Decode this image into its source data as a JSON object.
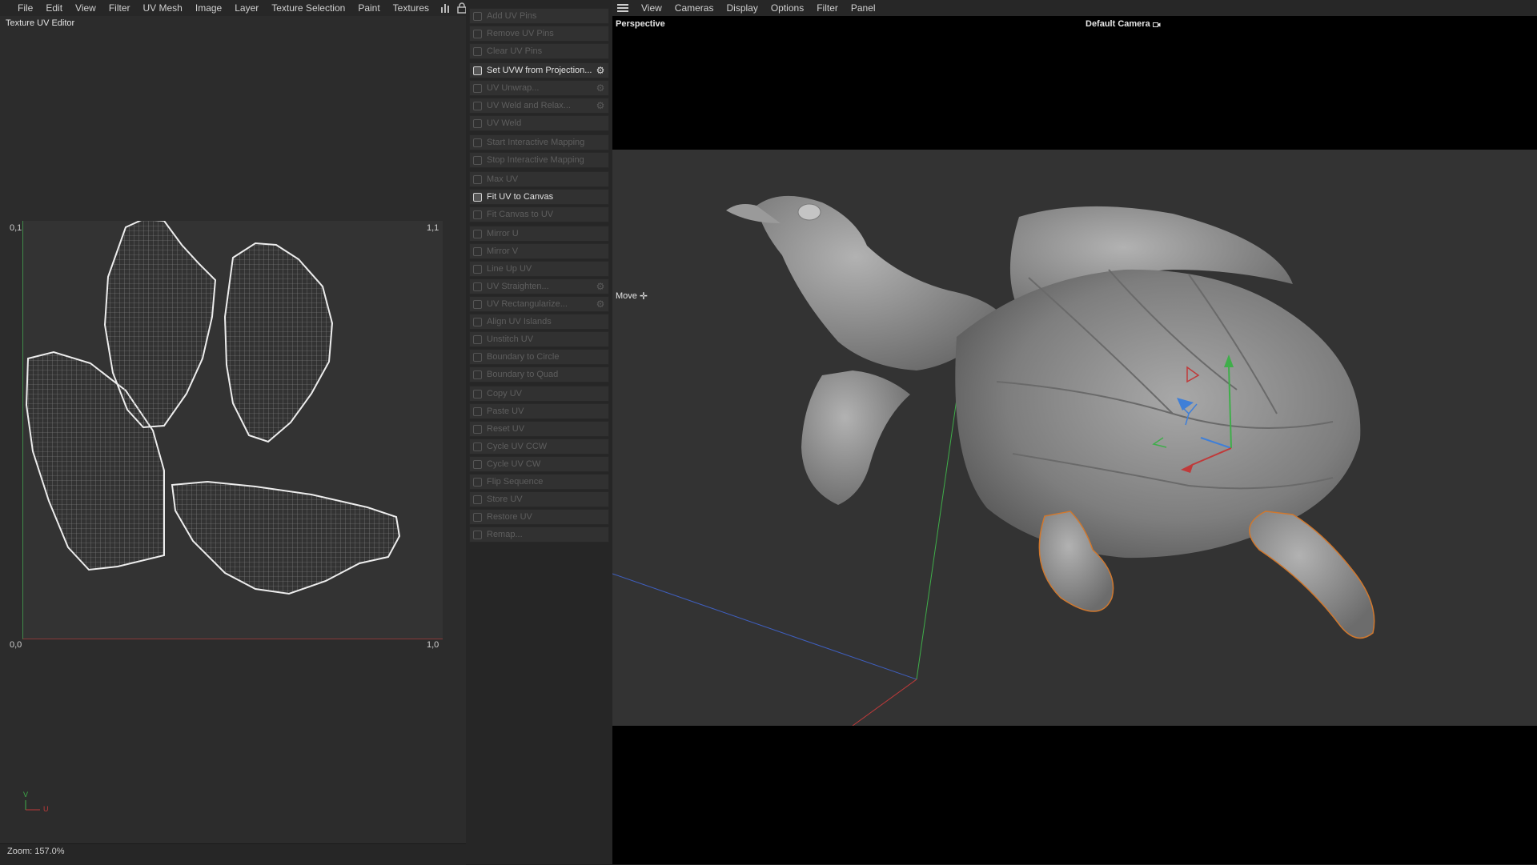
{
  "uv_editor": {
    "menu": [
      "File",
      "Edit",
      "View",
      "Filter",
      "UV Mesh",
      "Image",
      "Layer",
      "Texture Selection",
      "Paint",
      "Textures"
    ],
    "title": "Texture UV Editor",
    "corners": {
      "top_left": "0,1",
      "top_right": "1,1",
      "bottom_left": "0,0",
      "bottom_right": "1,0"
    },
    "axis_v": "V",
    "axis_u": "U",
    "zoom": "Zoom: 157.0%"
  },
  "command_panel": {
    "groups": [
      [
        {
          "label": "Add UV Pins",
          "enabled": false
        },
        {
          "label": "Remove UV Pins",
          "enabled": false
        },
        {
          "label": "Clear UV Pins",
          "enabled": false
        }
      ],
      [
        {
          "label": "Set UVW from Projection...",
          "enabled": true,
          "gear": true
        },
        {
          "label": "UV Unwrap...",
          "enabled": false,
          "gear": true
        },
        {
          "label": "UV Weld and Relax...",
          "enabled": false,
          "gear": true
        },
        {
          "label": "UV Weld",
          "enabled": false
        }
      ],
      [
        {
          "label": "Start Interactive Mapping",
          "enabled": false
        },
        {
          "label": "Stop Interactive Mapping",
          "enabled": false
        }
      ],
      [
        {
          "label": "Max UV",
          "enabled": false
        },
        {
          "label": "Fit UV to Canvas",
          "enabled": true
        },
        {
          "label": "Fit Canvas to UV",
          "enabled": false
        }
      ],
      [
        {
          "label": "Mirror U",
          "enabled": false
        },
        {
          "label": "Mirror V",
          "enabled": false
        },
        {
          "label": "Line Up UV",
          "enabled": false
        },
        {
          "label": "UV Straighten...",
          "enabled": false,
          "gear": true
        },
        {
          "label": "UV Rectangularize...",
          "enabled": false,
          "gear": true
        },
        {
          "label": "Align UV Islands",
          "enabled": false
        },
        {
          "label": "Unstitch UV",
          "enabled": false
        },
        {
          "label": "Boundary to Circle",
          "enabled": false
        },
        {
          "label": "Boundary to Quad",
          "enabled": false
        }
      ],
      [
        {
          "label": "Copy UV",
          "enabled": false
        },
        {
          "label": "Paste UV",
          "enabled": false
        },
        {
          "label": "Reset UV",
          "enabled": false
        },
        {
          "label": "Cycle UV CCW",
          "enabled": false
        },
        {
          "label": "Cycle UV CW",
          "enabled": false
        },
        {
          "label": "Flip Sequence",
          "enabled": false
        },
        {
          "label": "Store UV",
          "enabled": false
        },
        {
          "label": "Restore UV",
          "enabled": false
        },
        {
          "label": "Remap...",
          "enabled": false
        }
      ]
    ]
  },
  "viewport": {
    "menu": [
      "View",
      "Cameras",
      "Display",
      "Options",
      "Filter",
      "Panel"
    ],
    "label": "Perspective",
    "camera": "Default Camera",
    "tool": "Move"
  }
}
